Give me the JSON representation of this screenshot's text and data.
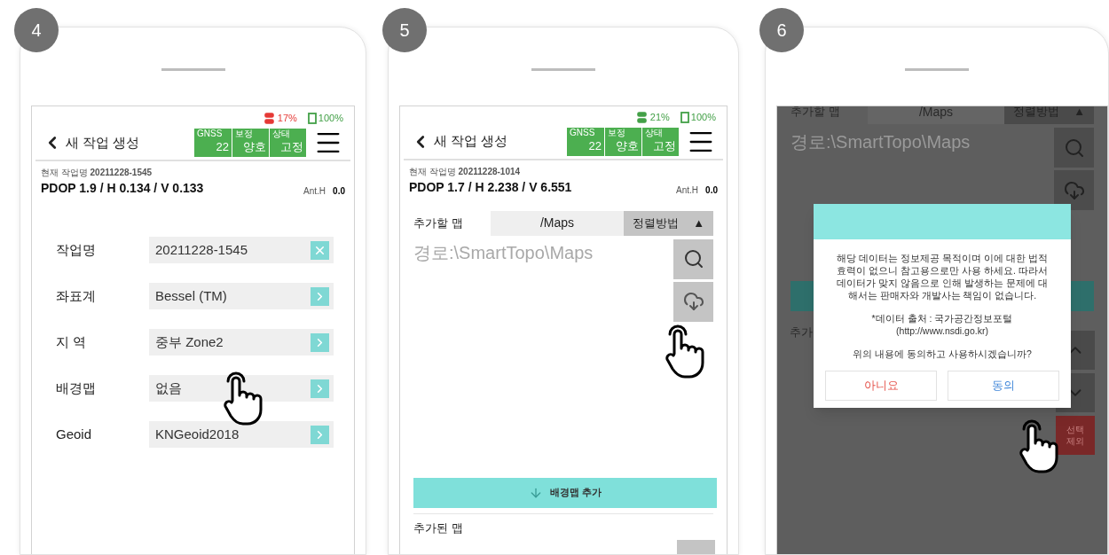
{
  "panels": [
    {
      "kind": "form",
      "step": "4",
      "status": {
        "signal": "17%",
        "color": "#e53935",
        "battery": "100%"
      },
      "title": "새 작업 생성",
      "gnss": [
        {
          "label": "GNSS",
          "value": "22"
        },
        {
          "label": "보정",
          "value": "양호"
        },
        {
          "label": "상태",
          "value": "고정"
        }
      ],
      "job_label": "현재 작업명",
      "job_name": "20211228-1545",
      "pdop": "PDOP 1.9 / H 0.134 / V 0.133",
      "ant_label": "Ant.H",
      "ant_value": "0.0",
      "fields": [
        {
          "label": "작업명",
          "value": "20211228-1545",
          "kind": "clear"
        },
        {
          "label": "좌표계",
          "value": "Bessel (TM)",
          "kind": "next"
        },
        {
          "label": "지 역",
          "value": "중부 Zone2",
          "kind": "next"
        },
        {
          "label": "배경맵",
          "value": "없음",
          "kind": "next"
        },
        {
          "label": "Geoid",
          "value": "KNGeoid2018",
          "kind": "next"
        }
      ]
    },
    {
      "kind": "maps",
      "step": "5",
      "status": {
        "signal": "21%",
        "color": "#43a047",
        "battery": "100%"
      },
      "title": "새 작업 생성",
      "gnss": [
        {
          "label": "GNSS",
          "value": "22"
        },
        {
          "label": "보정",
          "value": "양호"
        },
        {
          "label": "상태",
          "value": "고정"
        }
      ],
      "job_label": "현재 작업명",
      "job_name": "20211228-1014",
      "pdop": "PDOP 1.7 / H 2.238 / V 6.551",
      "ant_label": "Ant.H",
      "ant_value": "0.0",
      "map_label": "추가할 맵",
      "folder": "/Maps",
      "sort": "정렬방법",
      "sort_arrow": "▲",
      "path_placeholder": "경로:\\SmartTopo\\Maps",
      "add_button": "배경맵 추가",
      "added_label": "추가된 맵"
    },
    {
      "kind": "dialog",
      "step": "6",
      "map_label": "추가할 맵",
      "folder": "/Maps",
      "sort": "정렬방법",
      "sort_arrow": "▲",
      "path_placeholder": "경로:\\SmartTopo\\Maps",
      "added_label": "추가",
      "remove_button": "선택 제외",
      "dialog": {
        "message": "해당 데이터는 정보제공 목적이며 이에 대한 법적효력이 없으니 참고용으로만 사용 하세요. 따라서 데이터가 맞지 않음으로 인해 발생하는 문제에 대해서는 판매자와 개발사는 책임이 없습니다.",
        "source": "*데이터 출처 : 국가공간정보포털(http://www.nsdi.go.kr)",
        "question": "위의 내용에 동의하고 사용하시겠습니까?",
        "buttons": [
          {
            "label": "아니요",
            "kind": "cancel"
          },
          {
            "label": "동의",
            "kind": "confirm"
          }
        ]
      }
    }
  ]
}
